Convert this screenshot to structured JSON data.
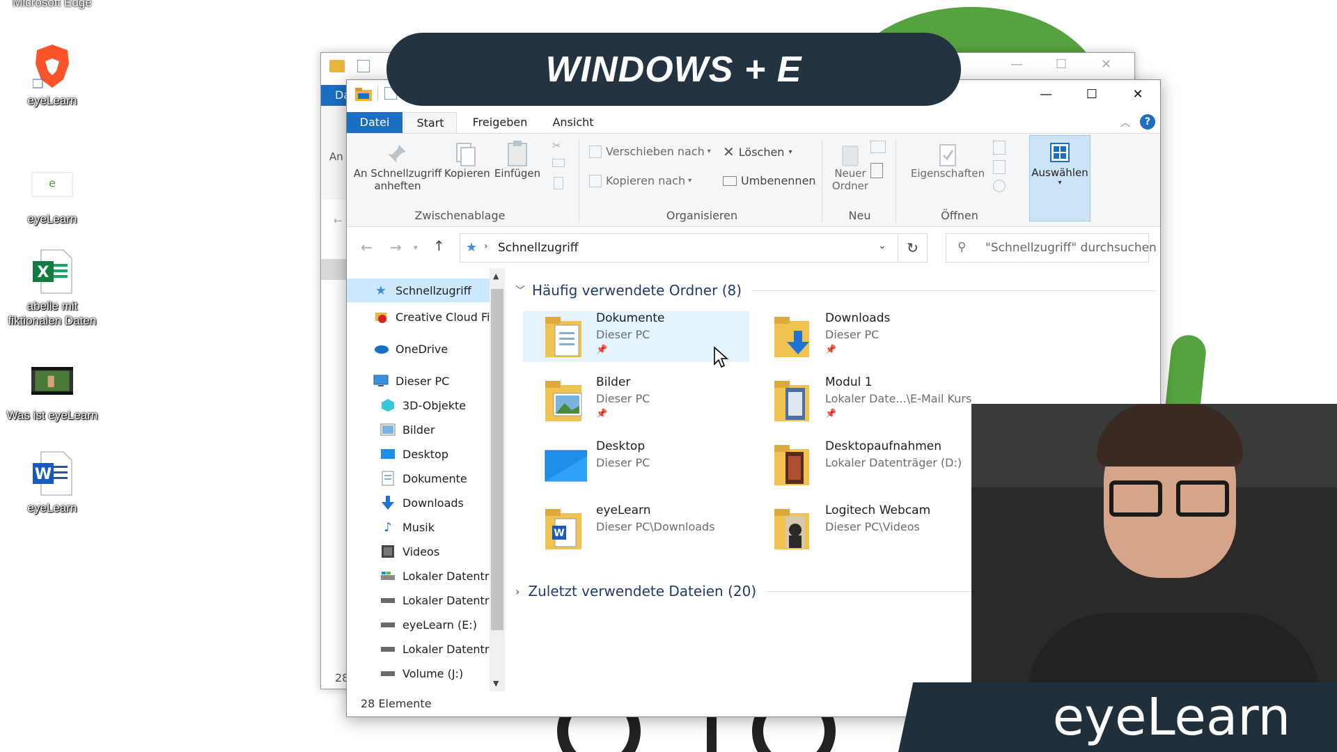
{
  "desktop": {
    "top_label": "Microsoft Edge",
    "icons": [
      {
        "label": "eyeLearn",
        "icon": "brave-browser-icon"
      },
      {
        "label": "eyeLearn",
        "icon": "eyelearn-app-icon"
      },
      {
        "label": "abelle mit fiktionalen Daten",
        "icon": "excel-file-icon"
      },
      {
        "label": "Was ist eyeLearn",
        "icon": "video-file-icon"
      },
      {
        "label": "eyeLearn",
        "icon": "word-file-icon"
      }
    ]
  },
  "overlay": {
    "title": "WINDOWS + E",
    "brand": "eyeLearn"
  },
  "back_window": {
    "tab_label": "Da",
    "ribbon_text": "An",
    "status_count": "28"
  },
  "explorer": {
    "window_controls": {
      "minimize": "—",
      "maximize": "☐",
      "close": "✕"
    },
    "tabs": [
      "Datei",
      "Start",
      "Freigeben",
      "Ansicht"
    ],
    "ribbon": {
      "clipboard": {
        "pin_label": "An Schnellzugriff anheften",
        "copy_label": "Kopieren",
        "paste_label": "Einfügen",
        "group": "Zwischenablage"
      },
      "organize": {
        "move_label": "Verschieben nach",
        "copyto_label": "Kopieren nach",
        "delete_label": "Löschen",
        "rename_label": "Umbenennen",
        "group": "Organisieren"
      },
      "new": {
        "folder_label": "Neuer Ordner",
        "group": "Neu"
      },
      "open": {
        "properties_label": "Eigenschaften",
        "group": "Öffnen"
      },
      "select": {
        "label": "Auswählen"
      }
    },
    "address": {
      "path": "Schnellzugriff",
      "search_placeholder": "\"Schnellzugriff\" durchsuchen"
    },
    "nav": [
      {
        "label": "Schnellzugriff",
        "icon": "star-icon",
        "selected": true
      },
      {
        "label": "Creative Cloud Fil",
        "icon": "creative-cloud-icon"
      },
      {
        "label": "OneDrive",
        "icon": "onedrive-icon"
      },
      {
        "label": "Dieser PC",
        "icon": "pc-icon"
      },
      {
        "label": "3D-Objekte",
        "icon": "3d-objects-icon"
      },
      {
        "label": "Bilder",
        "icon": "pictures-icon"
      },
      {
        "label": "Desktop",
        "icon": "desktop-icon"
      },
      {
        "label": "Dokumente",
        "icon": "documents-icon"
      },
      {
        "label": "Downloads",
        "icon": "downloads-icon"
      },
      {
        "label": "Musik",
        "icon": "music-icon"
      },
      {
        "label": "Videos",
        "icon": "videos-icon"
      },
      {
        "label": "Lokaler Datenträ",
        "icon": "drive-icon"
      },
      {
        "label": "Lokaler Datenträ",
        "icon": "drive-icon"
      },
      {
        "label": "eyeLearn (E:)",
        "icon": "drive-icon"
      },
      {
        "label": "Lokaler Datenträ",
        "icon": "drive-icon"
      },
      {
        "label": "Volume (J:)",
        "icon": "drive-icon"
      }
    ],
    "frequent_header": "Häufig verwendete Ordner (8)",
    "frequent": [
      {
        "name": "Dokumente",
        "location": "Dieser PC",
        "pinned": true,
        "icon": "documents-folder-icon"
      },
      {
        "name": "Downloads",
        "location": "Dieser PC",
        "pinned": true,
        "icon": "downloads-folder-icon"
      },
      {
        "name": "Bilder",
        "location": "Dieser PC",
        "pinned": true,
        "icon": "pictures-folder-icon"
      },
      {
        "name": "Modul 1",
        "location": "Lokaler Date...\\E-Mail Kurs",
        "pinned": true,
        "icon": "folder-icon"
      },
      {
        "name": "Desktop",
        "location": "Dieser PC",
        "pinned": false,
        "icon": "desktop-folder-icon"
      },
      {
        "name": "Desktopaufnahmen",
        "location": "Lokaler Datenträger (D:)",
        "pinned": false,
        "icon": "folder-icon"
      },
      {
        "name": "eyeLearn",
        "location": "Dieser PC\\Downloads",
        "pinned": false,
        "icon": "word-folder-icon"
      },
      {
        "name": "Logitech Webcam",
        "location": "Dieser PC\\Videos",
        "pinned": false,
        "icon": "folder-icon"
      }
    ],
    "recent_header": "Zuletzt verwendete Dateien (20)",
    "status": "28 Elemente"
  }
}
